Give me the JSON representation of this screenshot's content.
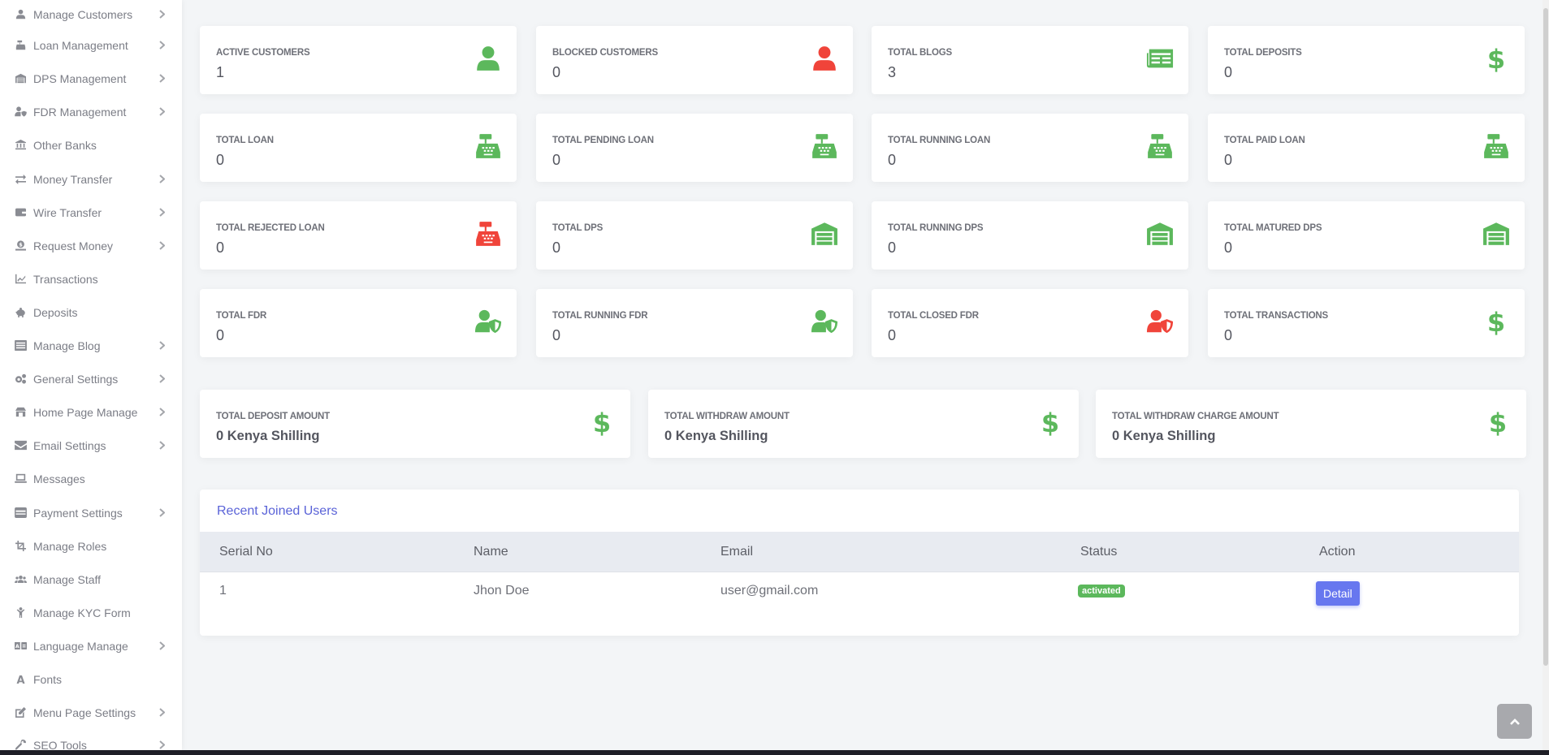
{
  "sidebar": {
    "items": [
      {
        "label": "Manage Customers",
        "icon": "user-icon",
        "has_submenu": true
      },
      {
        "label": "Loan Management",
        "icon": "cash-register-icon",
        "has_submenu": true
      },
      {
        "label": "DPS Management",
        "icon": "warehouse-icon",
        "has_submenu": true
      },
      {
        "label": "FDR Management",
        "icon": "user-shield-icon",
        "has_submenu": true
      },
      {
        "label": "Other Banks",
        "icon": "bank-icon",
        "has_submenu": false
      },
      {
        "label": "Money Transfer",
        "icon": "exchange-icon",
        "has_submenu": true
      },
      {
        "label": "Wire Transfer",
        "icon": "wallet-icon",
        "has_submenu": true
      },
      {
        "label": "Request Money",
        "icon": "money-request-icon",
        "has_submenu": true
      },
      {
        "label": "Transactions",
        "icon": "chart-line-icon",
        "has_submenu": false
      },
      {
        "label": "Deposits",
        "icon": "piggy-bank-icon",
        "has_submenu": false
      },
      {
        "label": "Manage Blog",
        "icon": "newspaper-icon",
        "has_submenu": true
      },
      {
        "label": "General Settings",
        "icon": "cogs-icon",
        "has_submenu": true
      },
      {
        "label": "Home Page Manage",
        "icon": "store-icon",
        "has_submenu": true
      },
      {
        "label": "Email Settings",
        "icon": "envelope-icon",
        "has_submenu": true
      },
      {
        "label": "Messages",
        "icon": "laptop-message-icon",
        "has_submenu": false
      },
      {
        "label": "Payment Settings",
        "icon": "credit-card-icon",
        "has_submenu": true
      },
      {
        "label": "Manage Roles",
        "icon": "crop-icon",
        "has_submenu": false
      },
      {
        "label": "Manage Staff",
        "icon": "users-icon",
        "has_submenu": false
      },
      {
        "label": "Manage KYC Form",
        "icon": "child-icon",
        "has_submenu": false
      },
      {
        "label": "Language Manage",
        "icon": "language-icon",
        "has_submenu": true
      },
      {
        "label": "Fonts",
        "icon": "font-icon",
        "has_submenu": false
      },
      {
        "label": "Menu Page Settings",
        "icon": "edit-icon",
        "has_submenu": true
      },
      {
        "label": "SEO Tools",
        "icon": "wrench-icon",
        "has_submenu": true
      }
    ]
  },
  "colors": {
    "success": "#5cb85c",
    "danger": "#f0443a",
    "primary": "#6777ef",
    "heading": "#5a63d8"
  },
  "stats": [
    {
      "title": "ACTIVE CUSTOMERS",
      "value": "1",
      "icon": "user-icon",
      "color": "green"
    },
    {
      "title": "BLOCKED CUSTOMERS",
      "value": "0",
      "icon": "user-icon",
      "color": "red"
    },
    {
      "title": "TOTAL BLOGS",
      "value": "3",
      "icon": "newspaper-icon",
      "color": "green"
    },
    {
      "title": "TOTAL DEPOSITS",
      "value": "0",
      "icon": "dollar-icon",
      "color": "green"
    },
    {
      "title": "TOTAL LOAN",
      "value": "0",
      "icon": "cash-register-icon",
      "color": "green"
    },
    {
      "title": "TOTAL PENDING LOAN",
      "value": "0",
      "icon": "cash-register-icon",
      "color": "green"
    },
    {
      "title": "TOTAL RUNNING LOAN",
      "value": "0",
      "icon": "cash-register-icon",
      "color": "green"
    },
    {
      "title": "TOTAL PAID LOAN",
      "value": "0",
      "icon": "cash-register-icon",
      "color": "green"
    },
    {
      "title": "TOTAL REJECTED LOAN",
      "value": "0",
      "icon": "cash-register-icon",
      "color": "red"
    },
    {
      "title": "TOTAL DPS",
      "value": "0",
      "icon": "warehouse-icon",
      "color": "green"
    },
    {
      "title": "TOTAL RUNNING DPS",
      "value": "0",
      "icon": "warehouse-icon",
      "color": "green"
    },
    {
      "title": "TOTAL MATURED DPS",
      "value": "0",
      "icon": "warehouse-icon",
      "color": "green"
    },
    {
      "title": "TOTAL FDR",
      "value": "0",
      "icon": "user-shield-icon",
      "color": "green"
    },
    {
      "title": "TOTAL RUNNING FDR",
      "value": "0",
      "icon": "user-shield-icon",
      "color": "green"
    },
    {
      "title": "TOTAL CLOSED FDR",
      "value": "0",
      "icon": "user-shield-icon",
      "color": "red"
    },
    {
      "title": "TOTAL TRANSACTIONS",
      "value": "0",
      "icon": "dollar-icon",
      "color": "green"
    }
  ],
  "amounts": [
    {
      "title": "TOTAL DEPOSIT AMOUNT",
      "value": "0 Kenya Shilling",
      "icon": "dollar-icon"
    },
    {
      "title": "TOTAL WITHDRAW AMOUNT",
      "value": "0 Kenya Shilling",
      "icon": "dollar-icon"
    },
    {
      "title": "TOTAL WITHDRAW CHARGE AMOUNT",
      "value": "0 Kenya Shilling",
      "icon": "dollar-icon"
    }
  ],
  "recent_users": {
    "title": "Recent Joined Users",
    "columns": [
      "Serial No",
      "Name",
      "Email",
      "Status",
      "Action"
    ],
    "rows": [
      {
        "serial": "1",
        "name": "Jhon Doe",
        "email": "user@gmail.com",
        "status": "activated",
        "action": "Detail"
      }
    ]
  }
}
